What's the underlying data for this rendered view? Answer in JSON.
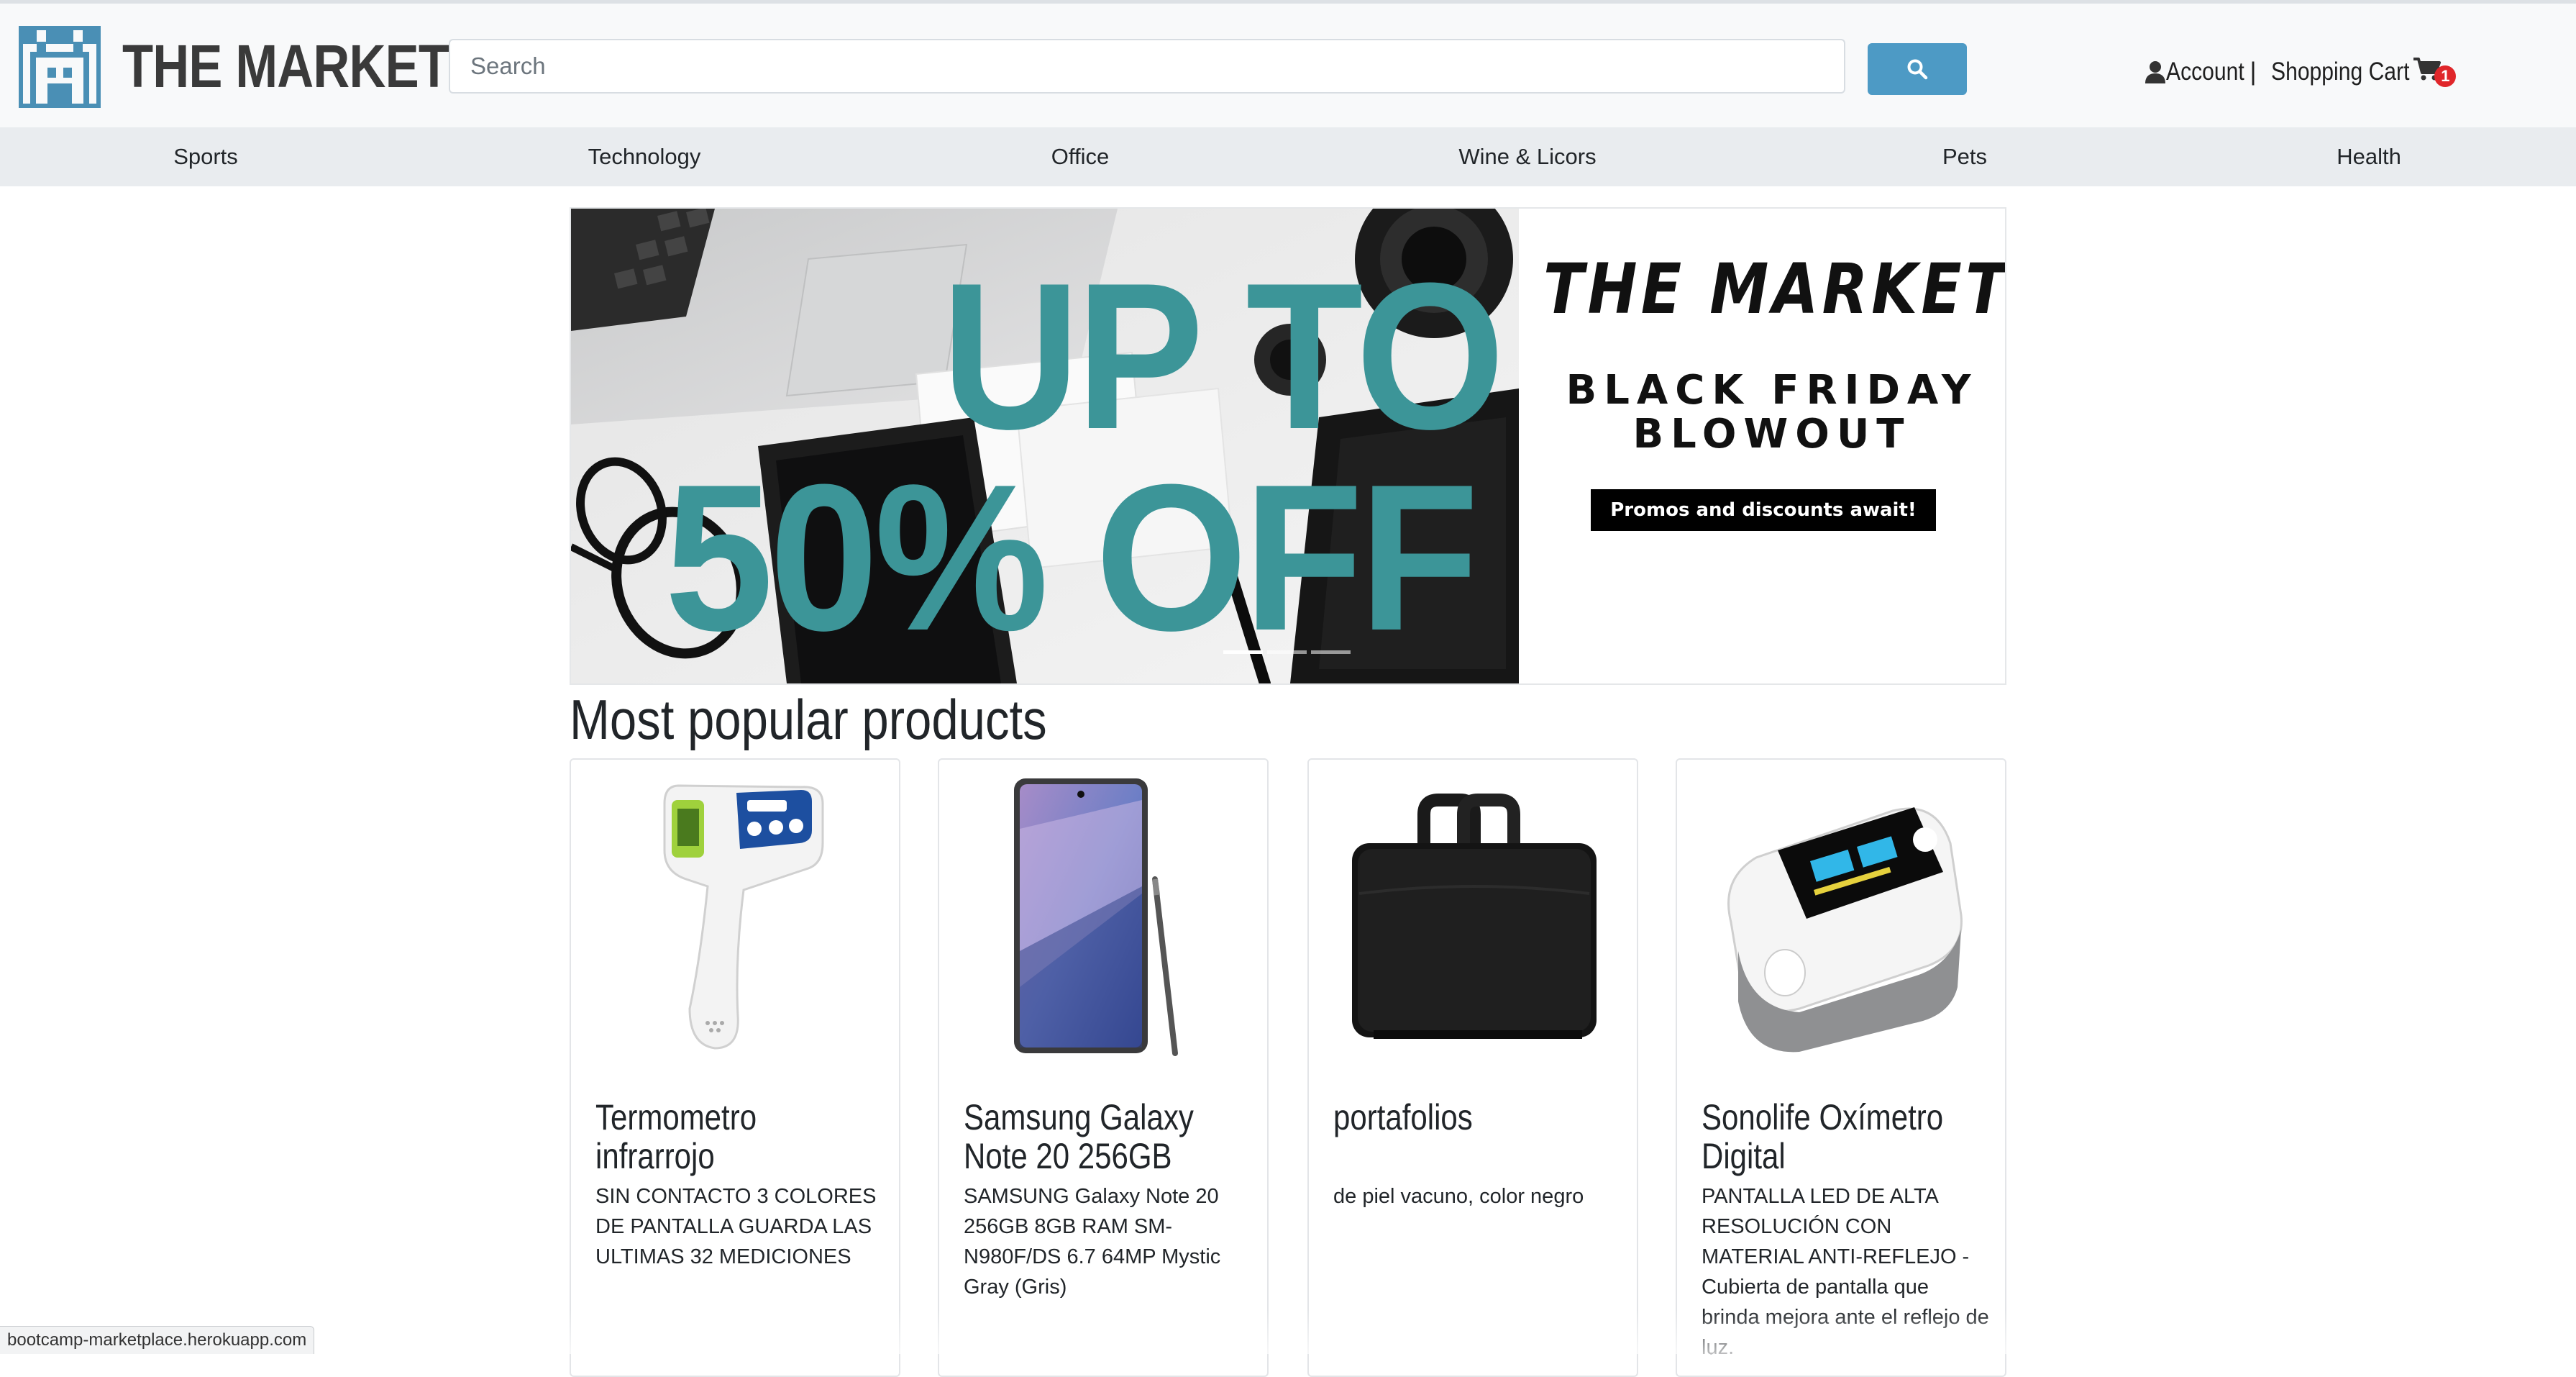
{
  "header": {
    "logo_text": "THE MARKET",
    "search": {
      "placeholder": "Search",
      "value": ""
    },
    "search_button_icon": "search-icon",
    "account_label": "Account",
    "separator": "|",
    "cart_label": "Shopping Cart",
    "cart_count": "1",
    "colors": {
      "search_button": "#4d9ac5",
      "badge": "#e0262a"
    }
  },
  "categories": [
    {
      "label": "Sports"
    },
    {
      "label": "Technology"
    },
    {
      "label": "Office"
    },
    {
      "label": "Wine & Licors"
    },
    {
      "label": "Pets"
    },
    {
      "label": "Health"
    }
  ],
  "banner": {
    "promo_line_1": "UP TO",
    "promo_line_2": "50% OFF",
    "brand": "THE MARKET",
    "headline_1": "BLACK FRIDAY",
    "headline_2": "BLOWOUT",
    "cta": "Promos and discounts await!",
    "slides": 3,
    "active_slide": 1,
    "accent_color": "#3c9598"
  },
  "section_title": "Most popular products",
  "products": [
    {
      "title": "Termometro infrarrojo",
      "description": "SIN CONTACTO 3 COLORES DE PANTALLA GUARDA LAS ULTIMAS 32 MEDICIONES"
    },
    {
      "title": "Samsung Galaxy Note 20 256GB",
      "description": "SAMSUNG Galaxy Note 20 256GB 8GB RAM SM-N980F/DS 6.7 64MP Mystic Gray (Gris)"
    },
    {
      "title": "portafolios",
      "description": "de piel vacuno, color negro"
    },
    {
      "title": "Sonolife Oxímetro Digital",
      "description": "PANTALLA LED DE ALTA RESOLUCIÓN CON MATERIAL ANTI-REFLEJO - Cubierta de pantalla que brinda mejora ante el reflejo de luz."
    }
  ],
  "status_url": "bootcamp-marketplace.herokuapp.com"
}
